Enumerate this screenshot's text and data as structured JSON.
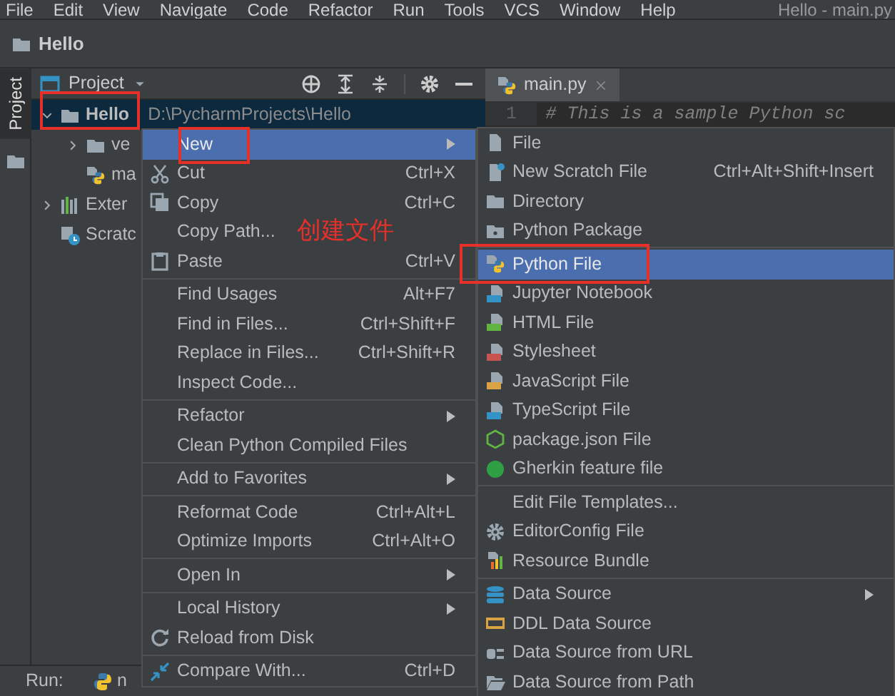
{
  "menu_bar": [
    "File",
    "Edit",
    "View",
    "Navigate",
    "Code",
    "Refactor",
    "Run",
    "Tools",
    "VCS",
    "Window",
    "Help"
  ],
  "window_title": "Hello - main.py",
  "breadcrumb": {
    "label": "Hello"
  },
  "tool_window_tabs": [
    {
      "label": "Project",
      "selected": true
    }
  ],
  "project_panel": {
    "title": "Project",
    "tree": [
      {
        "label": "Hello",
        "path": "D:\\PycharmProjects\\Hello",
        "kind": "folder",
        "expanded": true,
        "selected": true,
        "children": [
          {
            "label": "ve",
            "kind": "folder",
            "expanded": false,
            "selected": false
          },
          {
            "label": "ma",
            "kind": "python",
            "selected": false
          }
        ]
      },
      {
        "label": "Exter",
        "kind": "library",
        "expanded": false,
        "selected": false
      },
      {
        "label": "Scratc",
        "kind": "scratch",
        "selected": false
      }
    ]
  },
  "editor": {
    "tabs": [
      {
        "label": "main.py",
        "selected": true
      }
    ],
    "lines": [
      {
        "number": "1",
        "text": "# This is a sample Python sc"
      }
    ]
  },
  "context_menu": {
    "groups": [
      [
        {
          "label": "New",
          "submenu": true,
          "selected": true
        },
        {
          "label": "Cut",
          "shortcut": "Ctrl+X",
          "selected": false
        },
        {
          "label": "Copy",
          "shortcut": "Ctrl+C",
          "selected": false
        },
        {
          "label": "Copy Path...",
          "selected": false
        },
        {
          "label": "Paste",
          "shortcut": "Ctrl+V",
          "selected": false
        }
      ],
      [
        {
          "label": "Find Usages",
          "shortcut": "Alt+F7",
          "selected": false
        },
        {
          "label": "Find in Files...",
          "shortcut": "Ctrl+Shift+F",
          "selected": false
        },
        {
          "label": "Replace in Files...",
          "shortcut": "Ctrl+Shift+R",
          "selected": false
        },
        {
          "label": "Inspect Code...",
          "selected": false
        }
      ],
      [
        {
          "label": "Refactor",
          "submenu": true,
          "selected": false
        },
        {
          "label": "Clean Python Compiled Files",
          "selected": false
        }
      ],
      [
        {
          "label": "Add to Favorites",
          "submenu": true,
          "selected": false
        }
      ],
      [
        {
          "label": "Reformat Code",
          "shortcut": "Ctrl+Alt+L",
          "selected": false
        },
        {
          "label": "Optimize Imports",
          "shortcut": "Ctrl+Alt+O",
          "selected": false
        }
      ],
      [
        {
          "label": "Open In",
          "submenu": true,
          "selected": false
        }
      ],
      [
        {
          "label": "Local History",
          "submenu": true,
          "selected": false
        },
        {
          "label": "Reload from Disk",
          "selected": false
        }
      ],
      [
        {
          "label": "Compare With...",
          "shortcut": "Ctrl+D",
          "selected": false
        }
      ]
    ]
  },
  "submenu": {
    "groups": [
      [
        {
          "label": "File",
          "selected": false
        },
        {
          "label": "New Scratch File",
          "shortcut": "Ctrl+Alt+Shift+Insert",
          "selected": false
        },
        {
          "label": "Directory",
          "selected": false
        },
        {
          "label": "Python Package",
          "selected": false
        }
      ],
      [
        {
          "label": "Python File",
          "selected": true
        },
        {
          "label": "Jupyter Notebook",
          "selected": false
        },
        {
          "label": "HTML File",
          "selected": false
        },
        {
          "label": "Stylesheet",
          "selected": false
        },
        {
          "label": "JavaScript File",
          "selected": false
        },
        {
          "label": "TypeScript File",
          "selected": false
        },
        {
          "label": "package.json File",
          "selected": false
        },
        {
          "label": "Gherkin feature file",
          "selected": false
        }
      ],
      [
        {
          "label": "Edit File Templates...",
          "selected": false
        },
        {
          "label": "EditorConfig File",
          "selected": false
        },
        {
          "label": "Resource Bundle",
          "selected": false
        }
      ],
      [
        {
          "label": "Data Source",
          "submenu": true,
          "selected": false
        },
        {
          "label": "DDL Data Source",
          "selected": false
        },
        {
          "label": "Data Source from URL",
          "selected": false
        },
        {
          "label": "Data Source from Path",
          "selected": false
        }
      ]
    ]
  },
  "annotation": {
    "text": "创建文件"
  },
  "run_bar": {
    "label": "Run:",
    "tab": "n"
  }
}
